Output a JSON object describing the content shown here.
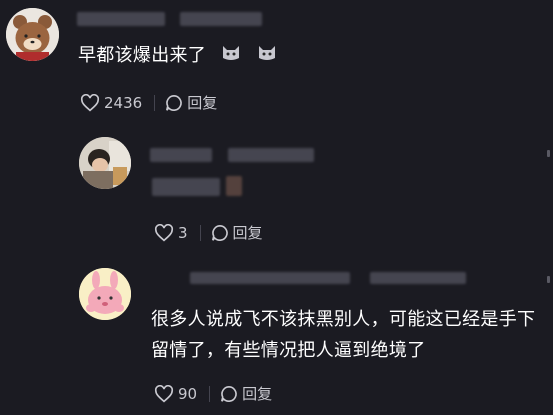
{
  "comments": [
    {
      "text": "早都该爆出来了",
      "emoji": [
        "cat-emoji",
        "cat-emoji"
      ],
      "likes": "2436",
      "reply_label": "回复"
    },
    {
      "likes": "3",
      "reply_label": "回复"
    },
    {
      "text_line1": "很多人说成飞不该抹黑别人，可能这已经是手下",
      "text_line2": "留情了，有些情况把人逼到绝境了",
      "likes": "90",
      "reply_label": "回复"
    }
  ],
  "icons": {
    "like": "heart-icon",
    "reply": "chat-bubble-icon"
  },
  "colors": {
    "background": "#1b1b22",
    "text": "#ffffff",
    "muted": "#c9c9d0"
  }
}
